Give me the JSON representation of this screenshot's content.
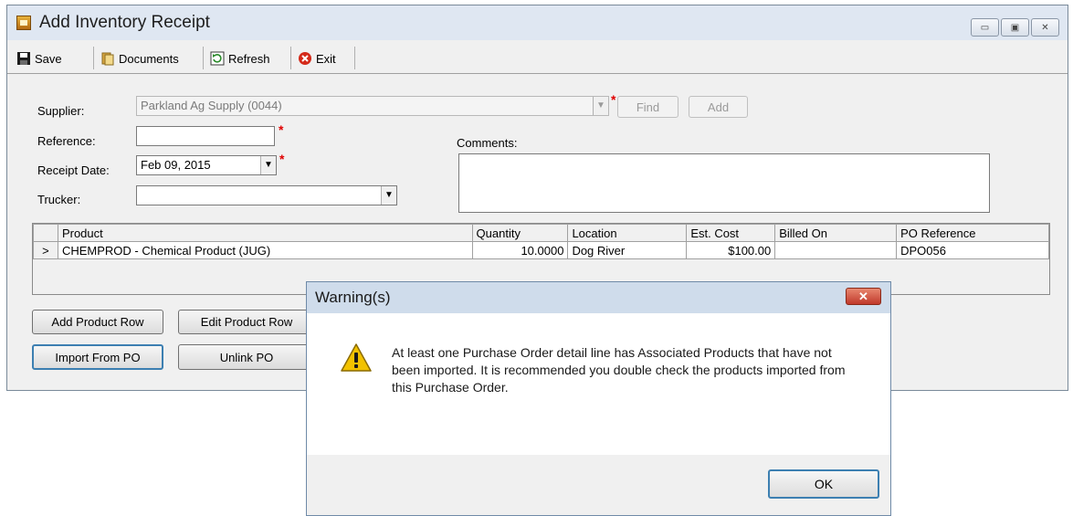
{
  "window": {
    "title": "Add Inventory Receipt",
    "controls": {
      "minimize": "▭",
      "maximize": "▣",
      "close": "✕"
    }
  },
  "toolbar": {
    "save_label": "Save",
    "documents_label": "Documents",
    "refresh_label": "Refresh",
    "exit_label": "Exit"
  },
  "form": {
    "supplier_label": "Supplier:",
    "supplier_value": "Parkland Ag Supply (0044)",
    "find_label": "Find",
    "add_label": "Add",
    "reference_label": "Reference:",
    "reference_value": "",
    "receipt_date_label": "Receipt Date:",
    "receipt_date_value": "Feb 09, 2015",
    "trucker_label": "Trucker:",
    "trucker_value": "",
    "comments_label": "Comments:",
    "comments_value": "",
    "required_marker": "*"
  },
  "grid": {
    "columns": [
      "Product",
      "Quantity",
      "Location",
      "Est. Cost",
      "Billed On",
      "PO Reference"
    ],
    "rows": [
      {
        "indicator": ">",
        "product": "CHEMPROD - Chemical Product (JUG)",
        "quantity": "10.0000",
        "location": "Dog River",
        "est_cost": "$100.00",
        "billed_on": "",
        "po_reference": "DPO056"
      }
    ]
  },
  "actions": {
    "add_product_row": "Add Product Row",
    "edit_product_row": "Edit Product Row",
    "import_from_po": "Import From PO",
    "unlink_po": "Unlink PO"
  },
  "dialog": {
    "title": "Warning(s)",
    "message": "At least one Purchase Order detail line has Associated Products that have not been imported. It is recommended you double check the products imported from this Purchase Order.",
    "ok_label": "OK",
    "close_glyph": "✕"
  },
  "colors": {
    "required": "#e00000",
    "default_button_border": "#3c7fb1",
    "dialog_close": "#c0392b",
    "warning_icon": "#f2c200"
  },
  "icons": {
    "app": "package-icon",
    "save": "floppy-disk-icon",
    "documents": "documents-icon",
    "refresh": "refresh-icon",
    "exit": "exit-icon",
    "warning": "warning-triangle-icon"
  }
}
